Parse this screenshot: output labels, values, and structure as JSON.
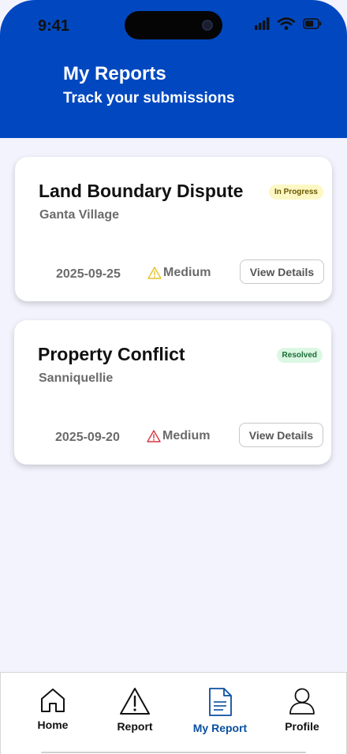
{
  "status_bar": {
    "time": "9:41"
  },
  "header": {
    "title": "My Reports",
    "subtitle": "Track your submissions",
    "background_color": "#0148c0"
  },
  "reports": [
    {
      "title": "Land Boundary Dispute",
      "location": "Ganta Village",
      "status": "In Progress",
      "status_color": "#fdf7c3",
      "date": "2025-09-25",
      "severity": "Medium",
      "severity_icon": "warning-icon",
      "severity_icon_color": "#e6c12b",
      "action_label": "View Details"
    },
    {
      "title": "Property Conflict",
      "location": "Sanniquellie",
      "status": "Resolved",
      "status_color": "#dcf7e3",
      "date": "2025-09-20",
      "severity": "Medium",
      "severity_icon": "warning-icon",
      "severity_icon_color": "#d9363e",
      "action_label": "View Details"
    }
  ],
  "bottom_nav": {
    "items": [
      {
        "label": "Home",
        "icon": "home-icon",
        "active": false
      },
      {
        "label": "Report",
        "icon": "warning-icon",
        "active": false
      },
      {
        "label": "My Report",
        "icon": "document-icon",
        "active": true
      },
      {
        "label": "Profile",
        "icon": "user-icon",
        "active": false
      }
    ],
    "active_color": "#0a4fa0"
  }
}
